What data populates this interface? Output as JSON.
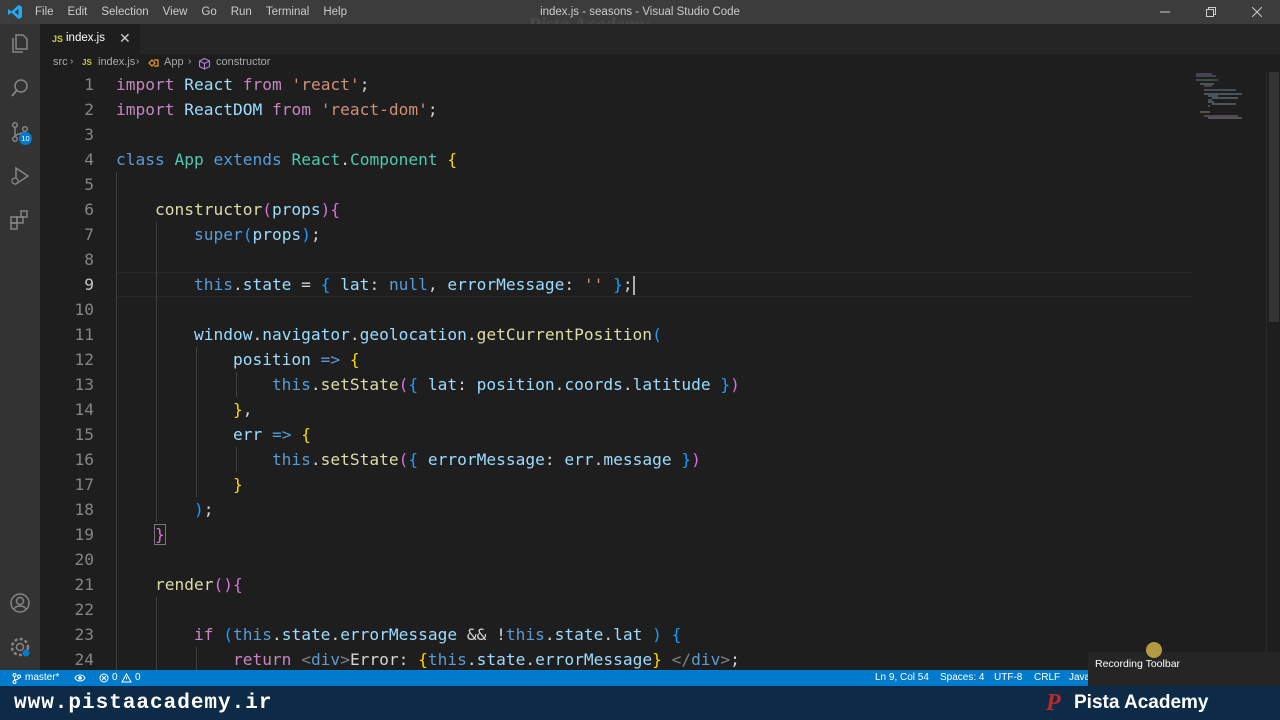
{
  "titlebar": {
    "menu": [
      "File",
      "Edit",
      "Selection",
      "View",
      "Go",
      "Run",
      "Terminal",
      "Help"
    ],
    "window_title": "index.js - seasons - Visual Studio Code",
    "watermark": "Pista Academy"
  },
  "activity_bar": {
    "items": [
      "explorer-icon",
      "search-icon",
      "source-control-icon",
      "run-debug-icon",
      "extensions-icon"
    ],
    "source_control_badge": "10",
    "bottom_items": [
      "account-icon",
      "manage-gear-icon"
    ]
  },
  "tabs": [
    {
      "label": "index.js",
      "icon": "JS",
      "active": true
    }
  ],
  "breadcrumb": [
    "src",
    "index.js",
    "App",
    "constructor"
  ],
  "breadcrumb_icons": {
    "file": "JS"
  },
  "editor": {
    "line_numbers": [
      "1",
      "2",
      "3",
      "4",
      "5",
      "6",
      "7",
      "8",
      "9",
      "10",
      "11",
      "12",
      "13",
      "14",
      "15",
      "16",
      "17",
      "18",
      "19",
      "20",
      "21",
      "22",
      "23",
      "24"
    ],
    "current_line": "9"
  },
  "statusbar": {
    "branch": "master*",
    "problems_errors": "0",
    "problems_warnings": "0",
    "cursor_position": "Ln 9, Col 54",
    "indentation": "Spaces: 4",
    "encoding": "UTF-8",
    "line_ending": "CRLF",
    "language": "Java"
  },
  "recording_toolbar": {
    "label": "Recording Toolbar"
  },
  "footer": {
    "website": "www.pistaacademy.ir",
    "brand": "Pista Academy",
    "logo_letter": "P"
  },
  "colors": {
    "accent": "#007acc",
    "footer_bg": "#0d2a47",
    "editor_bg": "#1e1e1e"
  }
}
